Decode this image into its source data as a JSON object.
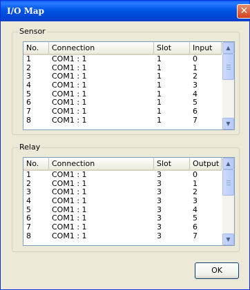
{
  "window": {
    "title": "I/O Map",
    "close_glyph": "✕"
  },
  "sensor": {
    "label": "Sensor",
    "columns": [
      "No.",
      "Connection",
      "Slot",
      "Input"
    ],
    "rows": [
      [
        "1",
        "COM1 : 1",
        "1",
        "0"
      ],
      [
        "2",
        "COM1 : 1",
        "1",
        "1"
      ],
      [
        "3",
        "COM1 : 1",
        "1",
        "2"
      ],
      [
        "4",
        "COM1 : 1",
        "1",
        "3"
      ],
      [
        "5",
        "COM1 : 1",
        "1",
        "4"
      ],
      [
        "6",
        "COM1 : 1",
        "1",
        "5"
      ],
      [
        "7",
        "COM1 : 1",
        "1",
        "6"
      ],
      [
        "8",
        "COM1 : 1",
        "1",
        "7"
      ]
    ]
  },
  "relay": {
    "label": "Relay",
    "columns": [
      "No.",
      "Connection",
      "Slot",
      "Output"
    ],
    "rows": [
      [
        "1",
        "COM1 : 1",
        "3",
        "0"
      ],
      [
        "2",
        "COM1 : 1",
        "3",
        "1"
      ],
      [
        "3",
        "COM1 : 1",
        "3",
        "2"
      ],
      [
        "4",
        "COM1 : 1",
        "3",
        "3"
      ],
      [
        "5",
        "COM1 : 1",
        "3",
        "4"
      ],
      [
        "6",
        "COM1 : 1",
        "3",
        "5"
      ],
      [
        "7",
        "COM1 : 1",
        "3",
        "6"
      ],
      [
        "8",
        "COM1 : 1",
        "3",
        "7"
      ]
    ]
  },
  "ok_button": {
    "label": "OK"
  },
  "scrollbar": {
    "up_glyph": "▲",
    "down_glyph": "▼"
  }
}
